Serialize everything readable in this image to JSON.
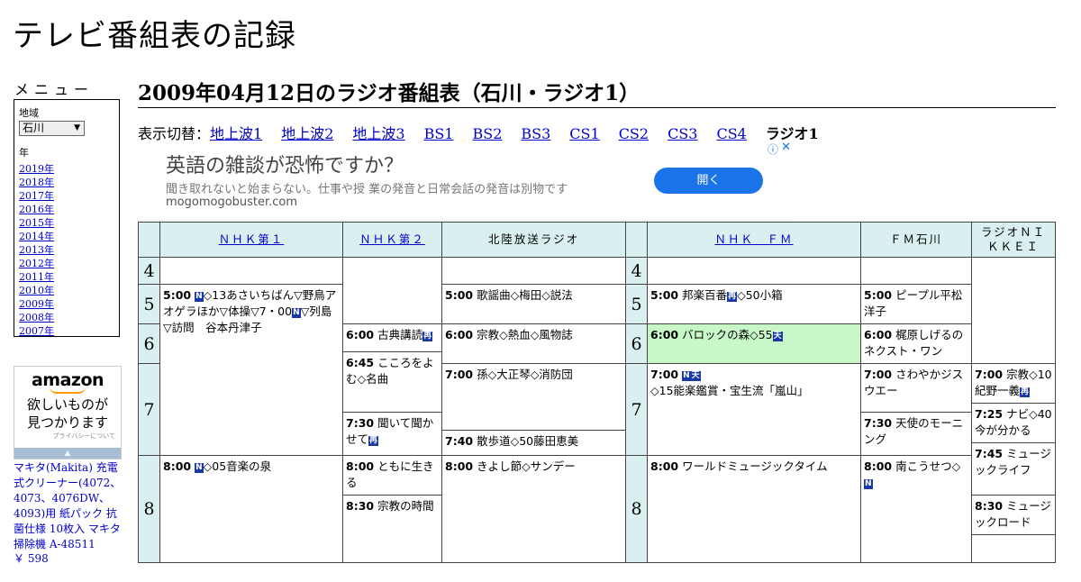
{
  "site": {
    "title": "テレビ番組表の記録"
  },
  "sidebar": {
    "menu_title": "メニュー",
    "region_label": "地域",
    "region_value": "石川",
    "year_label": "年",
    "years": [
      "2019年",
      "2018年",
      "2017年",
      "2016年",
      "2015年",
      "2014年",
      "2013年",
      "2012年",
      "2011年",
      "2010年",
      "2009年",
      "2008年",
      "2007年"
    ]
  },
  "amazon_ad": {
    "logo": "amazon",
    "line1": "欲しいものが",
    "line2": "見つかります",
    "privacy": "プライバシーについて"
  },
  "product": {
    "name": "マキタ(Makita) 充電式クリーナー(4072、4073、4076DW、4093)用 紙パック 抗菌仕様 10枚入 マキタ 掃除機 A-48511",
    "price": "￥ 598"
  },
  "page_title": "2009年04月12日のラジオ番組表（石川・ラジオ1）",
  "switcher": {
    "label": "表示切替：",
    "links": [
      "地上波1",
      "地上波2",
      "地上波3",
      "BS1",
      "BS2",
      "BS3",
      "CS1",
      "CS2",
      "CS3",
      "CS4"
    ],
    "current": "ラジオ1"
  },
  "banner_ad": {
    "headline": "英語の雑談が恐怖ですか？",
    "desc": "聞き取れないと始まらない。仕事や授 業の発音と日常会話の発音は別物です",
    "domain": "mogomogobuster.com",
    "button": "開く",
    "info_icon": "info-icon",
    "close_icon": "close-icon"
  },
  "schedule": {
    "channels": [
      "ＮＨＫ第１",
      "ＮＨＫ第２",
      "北陸放送ラジオ",
      "ＮＨＫ　ＦＭ",
      "ＦＭ石川",
      "ラジオＮＩＫＫＥＩ"
    ],
    "hours_left": [
      "4",
      "5",
      "6",
      "7",
      "8"
    ],
    "hours_right": [
      "4",
      "5",
      "6",
      "7",
      "8"
    ],
    "tags": {
      "n": "N",
      "ten": "天",
      "sai": "再"
    },
    "programs": {
      "nhk1_0500_time": "5:00",
      "nhk1_0500_a": "◇13あさいちばん▽野鳥アオゲラほか▽体操▽7・00",
      "nhk1_0500_b": "▽列島▽訪問　谷本丹津子",
      "nhk1_0800_time": "8:00",
      "nhk1_0800": "◇05音楽の泉",
      "nhk2_0600_time": "6:00",
      "nhk2_0600": "古典講読",
      "nhk2_0645_time": "6:45",
      "nhk2_0645": "こころをよむ◇名曲",
      "nhk2_0730_time": "7:30",
      "nhk2_0730": "聞いて聞かせて",
      "nhk2_0800_time": "8:00",
      "nhk2_0800": "ともに生きる",
      "nhk2_0830_time": "8:30",
      "nhk2_0830": "宗教の時間",
      "mro_0500_time": "5:00",
      "mro_0500": "歌謡曲◇梅田◇説法",
      "mro_0600_time": "6:00",
      "mro_0600": "宗教◇熱血◇風物誌",
      "mro_0700_time": "7:00",
      "mro_0700": "孫◇大正琴◇消防団",
      "mro_0740_time": "7:40",
      "mro_0740": "散歩道◇50藤田恵美",
      "mro_0800_time": "8:00",
      "mro_0800": "きよし節◇サンデー",
      "fm_0500_time": "5:00",
      "fm_0500_a": "邦楽百番",
      "fm_0500_b": "◇50小箱",
      "fm_0600_time": "6:00",
      "fm_0600": "バロックの森◇55",
      "fm_0700_time": "7:00",
      "fm_0700": "◇15能楽鑑賞・宝生流「嵐山」",
      "fm_0800_time": "8:00",
      "fm_0800": "ワールドミュージックタイム",
      "fmi_0500_time": "5:00",
      "fmi_0500": "ピープル平松洋子",
      "fmi_0600_time": "6:00",
      "fmi_0600": "梶原しげるのネクスト・ワン",
      "fmi_0700_time": "7:00",
      "fmi_0700": "さわやかジスウエー",
      "fmi_0730_time": "7:30",
      "fmi_0730": "天使のモーニング",
      "fmi_0800_time": "8:00",
      "fmi_0800": "南こうせつ◇",
      "nikkei_0700_time": "7:00",
      "nikkei_0700": "宗教◇10紀野一義",
      "nikkei_0725_time": "7:25",
      "nikkei_0725": "ナビ◇40今が分かる",
      "nikkei_0745_time": "7:45",
      "nikkei_0745": "ミュージックライフ",
      "nikkei_0830_time": "8:30",
      "nikkei_0830": "ミュージックロード"
    }
  }
}
